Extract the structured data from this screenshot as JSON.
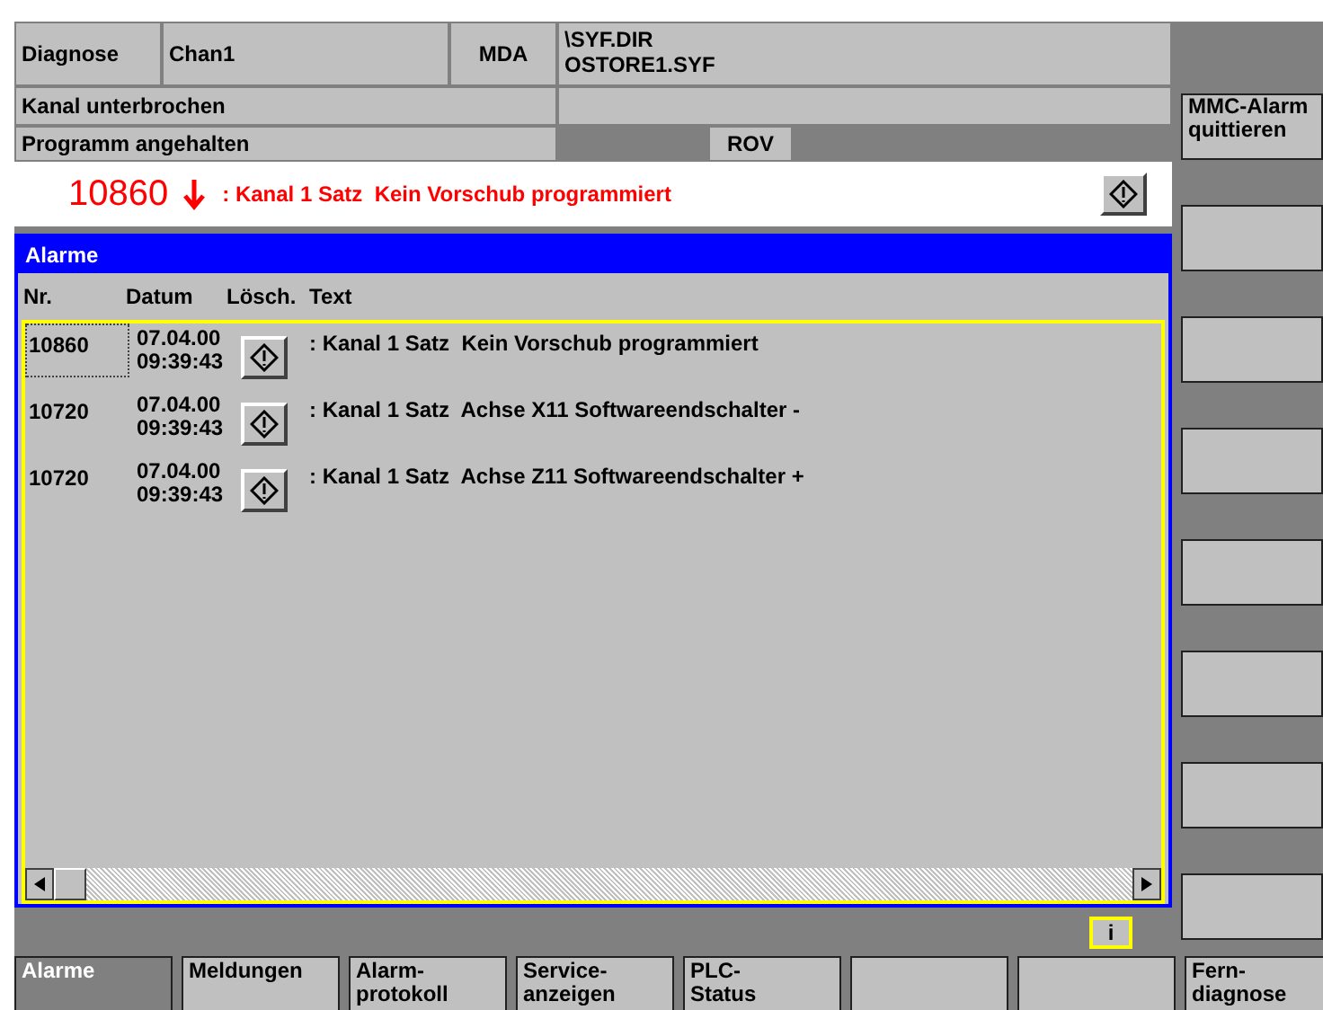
{
  "header": {
    "area": "Diagnose",
    "channel": "Chan1",
    "mode": "MDA",
    "program_path": "\\SYF.DIR\nOSTORE1.SYF"
  },
  "status": {
    "channel_state": "Kanal unterbrochen",
    "program_state": "Programm angehalten",
    "override": "ROV"
  },
  "current_alarm": {
    "number": "10860",
    "text": ": Kanal 1 Satz  Kein Vorschub programmiert"
  },
  "alarm_panel": {
    "title": "Alarme",
    "columns": [
      "Nr.",
      "Datum",
      "Lösch.",
      "Text"
    ],
    "rows": [
      {
        "number": "10860",
        "date": "07.04.00",
        "time": "09:39:43",
        "text": ": Kanal 1 Satz  Kein Vorschub programmiert",
        "selected": true
      },
      {
        "number": "10720",
        "date": "07.04.00",
        "time": "09:39:43",
        "text": ": Kanal 1 Satz  Achse X11 Softwareendschalter -",
        "selected": false
      },
      {
        "number": "10720",
        "date": "07.04.00",
        "time": "09:39:43",
        "text": ": Kanal 1 Satz  Achse Z11 Softwareendschalter +",
        "selected": false
      }
    ]
  },
  "info_button": "i",
  "vertical_softkeys": [
    {
      "kind": "labeled",
      "label": "MMC-Alarm\nquittieren"
    },
    {
      "kind": "blank"
    },
    {
      "kind": "blank"
    },
    {
      "kind": "blank"
    },
    {
      "kind": "blank"
    },
    {
      "kind": "blank"
    },
    {
      "kind": "blank"
    },
    {
      "kind": "blank"
    }
  ],
  "horizontal_softkeys": [
    {
      "kind": "labeled",
      "label": "Alarme",
      "selected": true
    },
    {
      "kind": "labeled",
      "label": "Meldungen",
      "selected": false
    },
    {
      "kind": "labeled",
      "label": "Alarm-\nprotokoll",
      "selected": false
    },
    {
      "kind": "labeled",
      "label": "Service-\nanzeigen",
      "selected": false
    },
    {
      "kind": "labeled",
      "label": "PLC-\nStatus",
      "selected": false
    },
    {
      "kind": "blank",
      "selected": false
    },
    {
      "kind": "blank",
      "selected": false
    },
    {
      "kind": "labeled",
      "label": "Fern-\ndiagnose",
      "selected": false
    }
  ]
}
